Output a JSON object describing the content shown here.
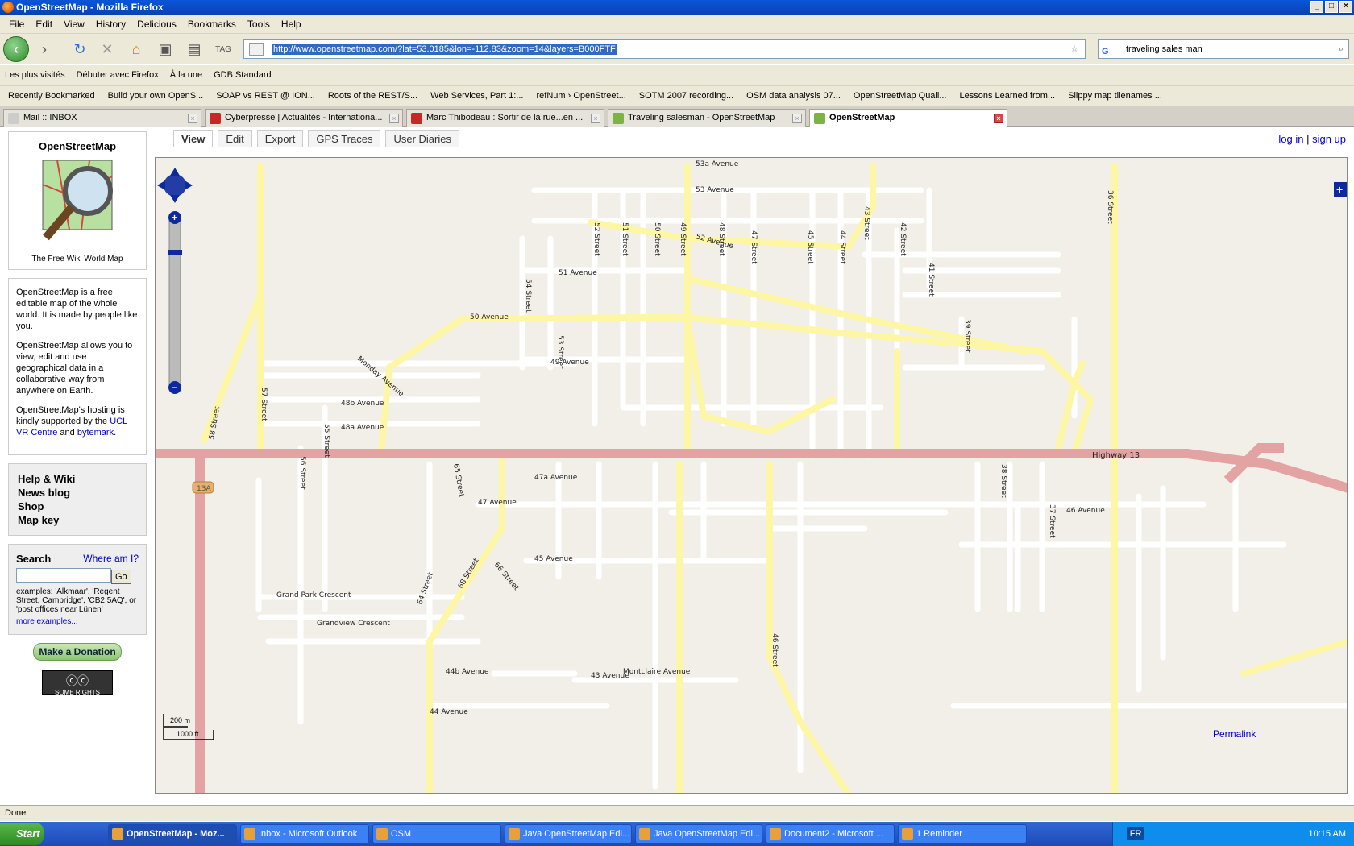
{
  "window": {
    "title": "OpenStreetMap - Mozilla Firefox"
  },
  "menubar": [
    "File",
    "Edit",
    "View",
    "History",
    "Delicious",
    "Bookmarks",
    "Tools",
    "Help"
  ],
  "navbar": {
    "url": "http://www.openstreetmap.com/?lat=53.0185&lon=-112.83&zoom=14&layers=B000FTF",
    "search": "traveling sales man"
  },
  "bookmarks1": [
    "Les plus visités",
    "Débuter avec Firefox",
    "À la une",
    "GDB Standard"
  ],
  "bookmarks2": [
    "Recently Bookmarked",
    "Build your own OpenS...",
    "SOAP vs REST @ ION...",
    "Roots of the REST/S...",
    "Web Services, Part 1:...",
    "refNum › OpenStreet...",
    "SOTM 2007 recording...",
    "OSM data analysis 07...",
    "OpenStreetMap Quali...",
    "Lessons Learned from...",
    "Slippy map tilenames ..."
  ],
  "tabs": [
    {
      "label": "Mail :: INBOX",
      "color": "#e0e0e0"
    },
    {
      "label": "Cyberpresse | Actualités - Internationa...",
      "color": "#c62828"
    },
    {
      "label": "Marc Thibodeau : Sortir de la rue...en ...",
      "color": "#c62828"
    },
    {
      "label": "Traveling salesman - OpenStreetMap",
      "color": "#7cb342"
    },
    {
      "label": "OpenStreetMap",
      "color": "#7cb342"
    }
  ],
  "sidebar": {
    "site_name": "OpenStreetMap",
    "tagline": "The Free Wiki World Map",
    "intro1": "OpenStreetMap is a free editable map of the whole world. It is made by people like you.",
    "intro2": "OpenStreetMap allows you to view, edit and use geographical data in a collaborative way from anywhere on Earth.",
    "intro3_pre": "OpenStreetMap's hosting is kindly supported by the ",
    "intro3_link1": "UCL VR Centre",
    "intro3_and": " and ",
    "intro3_link2": "bytemark",
    "links": [
      "Help & Wiki",
      "News blog",
      "Shop",
      "Map key"
    ],
    "search_title": "Search",
    "where_am_i": "Where am I?",
    "go": "Go",
    "examples": "examples: 'Alkmaar', 'Regent Street, Cambridge', 'CB2 5AQ', or 'post offices near Lünen'",
    "more_examples": "more examples...",
    "donate": "Make a Donation",
    "cc": "SOME RIGHTS RESERVED"
  },
  "topnav": {
    "tabs": [
      "View",
      "Edit",
      "Export",
      "GPS Traces",
      "User Diaries"
    ],
    "login": "log in",
    "signup": "sign up",
    "sep": " | "
  },
  "map": {
    "scale_m": "200 m",
    "scale_ft": "1000 ft",
    "permalink": "Permalink",
    "highway_label": "Highway 13",
    "route_shield": "13A",
    "labels": [
      {
        "t": "53 Avenue",
        "k": "street"
      },
      {
        "t": "53a Avenue",
        "k": "street"
      },
      {
        "t": "52 Avenue",
        "k": "street"
      },
      {
        "t": "51 Avenue",
        "k": "street"
      },
      {
        "t": "50 Avenue",
        "k": "street"
      },
      {
        "t": "49 Avenue",
        "k": "street"
      },
      {
        "t": "48b Avenue",
        "k": "street"
      },
      {
        "t": "48a Avenue",
        "k": "street"
      },
      {
        "t": "47a Avenue",
        "k": "street"
      },
      {
        "t": "47 Avenue",
        "k": "street"
      },
      {
        "t": "46 Avenue",
        "k": "street"
      },
      {
        "t": "45 Avenue",
        "k": "street"
      },
      {
        "t": "44b Avenue",
        "k": "street"
      },
      {
        "t": "44 Avenue",
        "k": "street"
      },
      {
        "t": "43 Avenue",
        "k": "street"
      },
      {
        "t": "Grand Park Crescent",
        "k": "street"
      },
      {
        "t": "Grandview Crescent",
        "k": "street"
      },
      {
        "t": "Montclaire Avenue",
        "k": "street"
      },
      {
        "t": "Monday Avenue",
        "k": "street"
      },
      {
        "t": "68 Street",
        "k": "street"
      },
      {
        "t": "66 Street",
        "k": "street"
      },
      {
        "t": "65 Street",
        "k": "street"
      },
      {
        "t": "64 Street",
        "k": "street"
      },
      {
        "t": "58 Street",
        "k": "street"
      },
      {
        "t": "57 Street",
        "k": "street"
      },
      {
        "t": "56 Street",
        "k": "street"
      },
      {
        "t": "55 Street",
        "k": "street"
      },
      {
        "t": "54 Street",
        "k": "street"
      },
      {
        "t": "53 Street",
        "k": "street"
      },
      {
        "t": "52 Street",
        "k": "street"
      },
      {
        "t": "51 Street",
        "k": "street"
      },
      {
        "t": "50 Street",
        "k": "street"
      },
      {
        "t": "49 Street",
        "k": "street"
      },
      {
        "t": "48 Street",
        "k": "street"
      },
      {
        "t": "47 Street",
        "k": "street"
      },
      {
        "t": "46 Street",
        "k": "street"
      },
      {
        "t": "45 Street",
        "k": "street"
      },
      {
        "t": "44 Street",
        "k": "street"
      },
      {
        "t": "43 Street",
        "k": "street"
      },
      {
        "t": "42 Street",
        "k": "street"
      },
      {
        "t": "41 Street",
        "k": "street"
      },
      {
        "t": "39 Street",
        "k": "street"
      },
      {
        "t": "38 Street",
        "k": "street"
      },
      {
        "t": "37 Street",
        "k": "street"
      },
      {
        "t": "36 Street",
        "k": "street"
      }
    ]
  },
  "status": "Done",
  "taskbar": {
    "start": "Start",
    "tasks": [
      "OpenStreetMap - Moz...",
      "Inbox - Microsoft Outlook",
      "OSM",
      "Java OpenStreetMap Edi...",
      "Java OpenStreetMap Edi...",
      "Document2 - Microsoft ...",
      "1 Reminder"
    ],
    "lang": "FR",
    "clock": "10:15 AM"
  }
}
